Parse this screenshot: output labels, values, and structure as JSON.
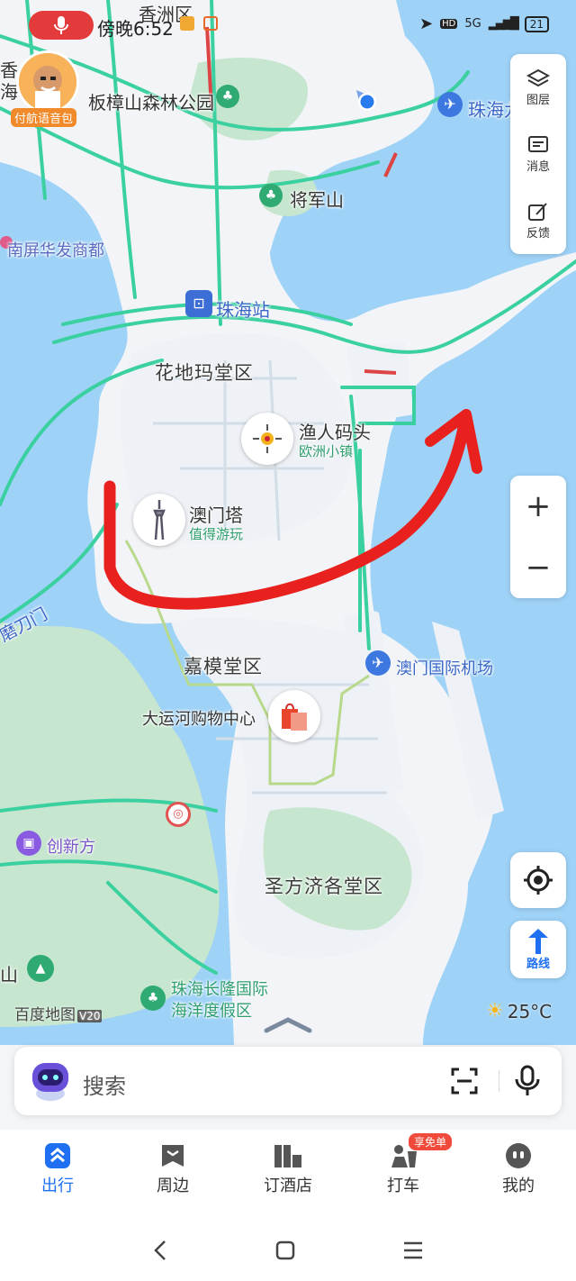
{
  "status": {
    "time": "傍晚6:52",
    "network": "5G",
    "hd": "HD",
    "battery": "21"
  },
  "avatar": {
    "tag": "付航语音包"
  },
  "map_labels": {
    "xiangzhou": "香洲区",
    "banzhangshan": "板樟山森林公园",
    "zhuhai_airport_partial": "珠海九",
    "jiangjunshan": "将军山",
    "nanping": "南屏华发商都",
    "zhuhai_station": "珠海站",
    "huadima": "花地玛堂区",
    "fishermans_wharf": "渔人码头",
    "fishermans_sub": "欧洲小镇",
    "macau_tower": "澳门塔",
    "macau_tower_sub": "值得游玩",
    "modaomen": "磨刀门",
    "jiamo": "嘉模堂区",
    "canal_mall": "大运河购物中心",
    "macau_airport": "澳门国际机场",
    "chuangxinfang": "创新方",
    "shengfangji": "圣方济各堂区",
    "changlong_1": "珠海长隆国际",
    "changlong_2": "海洋度假区",
    "left_mountain": "山",
    "left_partial_1": "香",
    "left_partial_2": "海"
  },
  "tools": {
    "layers": "图层",
    "messages": "消息",
    "feedback": "反馈",
    "zoom_in": "+",
    "zoom_out": "−",
    "route": "路线"
  },
  "weather": {
    "temp": "25°C",
    "icon": "sun-icon"
  },
  "watermark": {
    "text": "百度地图",
    "version": "V20"
  },
  "search": {
    "placeholder": "搜索"
  },
  "bottom_nav": {
    "items": [
      {
        "label": "出行",
        "active": true
      },
      {
        "label": "周边",
        "active": false
      },
      {
        "label": "订酒店",
        "active": false
      },
      {
        "label": "打车",
        "active": false,
        "badge": "享免单"
      },
      {
        "label": "我的",
        "active": false
      }
    ]
  },
  "colors": {
    "sea": "#9ed2f7",
    "land": "#f2f4f7",
    "green_land": "#c7e6cf",
    "road": "#3bd0a0",
    "annotation": "#e8201e",
    "accent": "#1f6ff2"
  }
}
